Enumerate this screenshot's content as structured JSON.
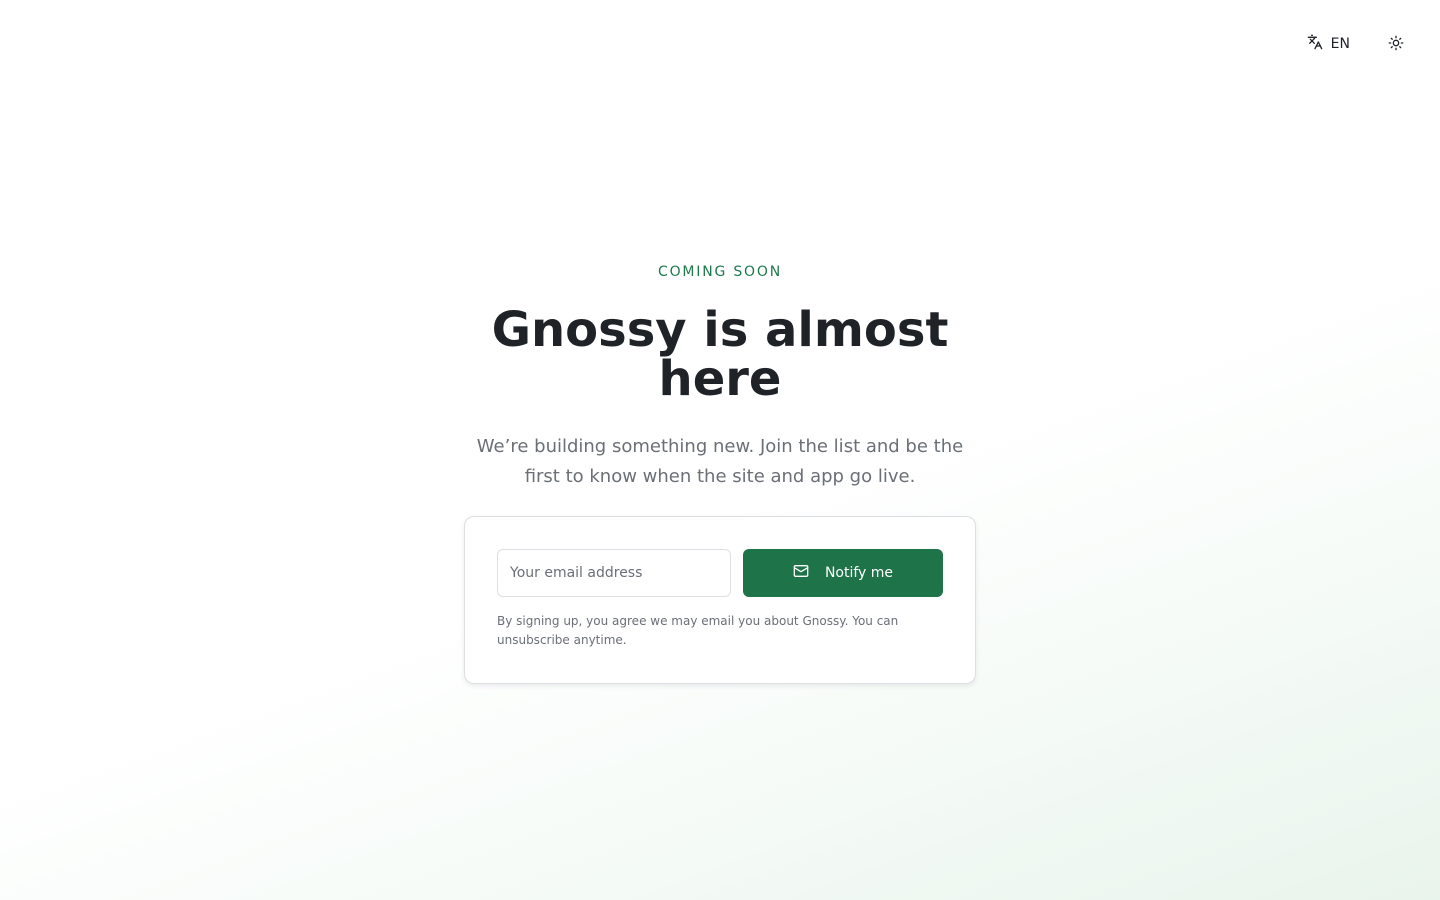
{
  "header": {
    "language_label": "EN",
    "language_icon": "translate-icon",
    "theme_icon": "sun-icon"
  },
  "hero": {
    "eyebrow": "COMING SOON",
    "title": "Gnossy is almost here",
    "subtitle": "We’re building something new. Join the list and be the first to know when the site and app go live."
  },
  "signup": {
    "email_placeholder": "Your email address",
    "email_value": "",
    "button_label": "Notify me",
    "button_icon": "mail-icon",
    "disclaimer": "By signing up, you agree we may email you about Gnossy. You can unsubscribe anytime."
  },
  "colors": {
    "accent": "#1e7448",
    "eyebrow": "#1e7a4b",
    "text": "#1f2328",
    "muted": "#6b6f76"
  }
}
